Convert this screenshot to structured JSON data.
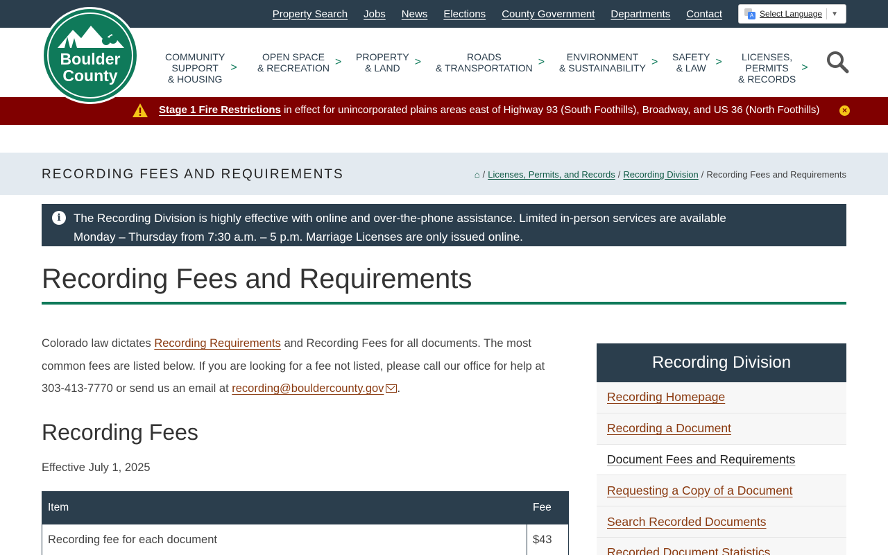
{
  "top_links": [
    "Property Search",
    "Jobs",
    "News",
    "Elections",
    "County Government",
    "Departments",
    "Contact"
  ],
  "language": {
    "label": "Select Language",
    "arrow": "▼"
  },
  "logo": {
    "line1": "Boulder",
    "line2": "County"
  },
  "nav": [
    {
      "line1": "Community",
      "line2": "Support",
      "line3": "& Housing"
    },
    {
      "line1": "Open Space",
      "line2": "& Recreation",
      "line3": ""
    },
    {
      "line1": "Property",
      "line2": "& Land",
      "line3": ""
    },
    {
      "line1": "Roads",
      "line2": "& Transportation",
      "line3": ""
    },
    {
      "line1": "Environment",
      "line2": "& Sustainability",
      "line3": ""
    },
    {
      "line1": "Safety",
      "line2": "& Law",
      "line3": ""
    },
    {
      "line1": "Licenses,",
      "line2": "Permits",
      "line3": "& Records"
    }
  ],
  "nav_chevron": ">",
  "alert": {
    "link": "Stage 1 Fire Restrictions",
    "text": " in effect for unincorporated plains areas east of Highway 93 (South Foothills), Broadway, and US 36 (North Foothills)",
    "close": "×"
  },
  "title_band": {
    "title": "Recording Fees and Requirements"
  },
  "breadcrumb": {
    "home_icon": "⌂",
    "sep": "/",
    "items": [
      "Licenses, Permits, and Records",
      "Recording Division"
    ],
    "current": "Recording Fees and Requirements"
  },
  "notice": {
    "icon": "i",
    "line1": "The Recording Division is highly effective with online and over-the-phone assistance. Limited in-person services are available",
    "line2": "Monday – Thursday from 7:30 a.m. – 5 p.m. Marriage Licenses are only issued online."
  },
  "page_title": "Recording Fees and Requirements",
  "intro": {
    "before": "Colorado law dictates ",
    "link1": "Recording Requirements",
    "middle": " and Recording Fees for all documents. The most common fees are listed below. If you are looking for a fee not listed, please call our office for help at 303-413-7770 or send us an email at ",
    "email": "recording@bouldercounty.gov",
    "after": "."
  },
  "fees_heading": "Recording Fees",
  "effective": "Effective July 1, 2025",
  "fee_table": {
    "headers": [
      "Item",
      "Fee"
    ],
    "rows": [
      [
        "Recording fee for each document",
        "$43"
      ]
    ]
  },
  "sidebar": {
    "title": "Recording Division",
    "items": [
      "Recording Homepage",
      "Recording a Document",
      "Document Fees and Requirements",
      "Requesting a Copy of a Document",
      "Search Recorded Documents",
      "Recorded Document Statistics"
    ],
    "current_index": 2
  },
  "colors": {
    "navy": "#2b3e4d",
    "green": "#0f7a5a",
    "alert_red": "#800000",
    "link_brown": "#8a3a10"
  }
}
